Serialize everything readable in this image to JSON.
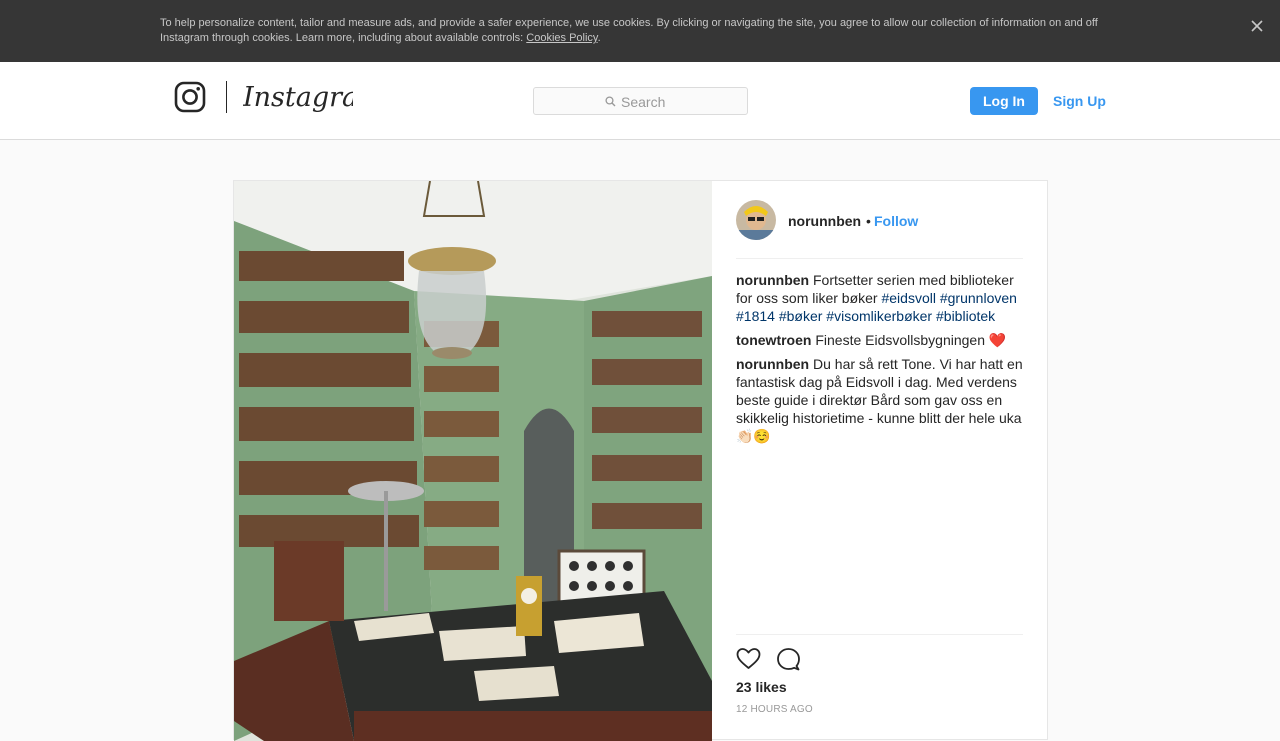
{
  "cookie_banner": {
    "text": "To help personalize content, tailor and measure ads, and provide a safer experience, we use cookies. By clicking or navigating the site, you agree to allow our collection of information on and off Instagram through cookies. Learn more, including about available controls: ",
    "link_label": "Cookies Policy",
    "suffix": ".",
    "close_icon": "close-icon"
  },
  "header": {
    "logo_icon": "instagram-glyph-icon",
    "wordmark": "Instagram",
    "search": {
      "placeholder": "Search",
      "icon": "search-icon"
    },
    "login_label": "Log In",
    "signup_label": "Sign Up",
    "accent_color": "#3897f0"
  },
  "post": {
    "image_alt": "Green-painted library room with bookshelves, a hanging glass lantern and a writing desk",
    "author": "norunnben",
    "separator": "•",
    "follow_label": "Follow",
    "comments": [
      {
        "user": "norunnben",
        "text": " Fortsetter serien med biblioteker for oss som liker bøker ",
        "hashtags": [
          "#eidsvoll",
          "#grunnloven",
          "#1814",
          "#bøker",
          "#visomlikerbøker",
          "#bibliotek"
        ]
      },
      {
        "user": "tonewtroen",
        "text": " Fineste Eidsvollsbygningen ❤️"
      },
      {
        "user": "norunnben",
        "text": " Du har så rett Tone. Vi har hatt en fantastisk dag på Eidsvoll i dag. Med verdens beste guide i direktør Bård som gav oss en skikkelig historietime - kunne blitt der hele uka👏🏻☺️"
      }
    ],
    "actions": {
      "like_icon": "heart-icon",
      "comment_icon": "speech-bubble-icon"
    },
    "likes": "23 likes",
    "timestamp": "12 hours ago"
  }
}
